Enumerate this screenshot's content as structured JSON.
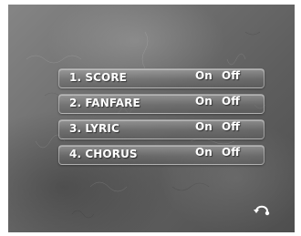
{
  "menu": {
    "items": [
      {
        "label": "1. SCORE",
        "on": "On",
        "off": "Off"
      },
      {
        "label": "2. FANFARE",
        "on": "On",
        "off": "Off"
      },
      {
        "label": "3. LYRIC",
        "on": "On",
        "off": "Off"
      },
      {
        "label": "4. CHORUS",
        "on": "On",
        "off": "Off"
      }
    ]
  },
  "icons": {
    "return": "return-icon"
  },
  "colors": {
    "text": "#ffffff",
    "background": "#6f6f6f"
  }
}
